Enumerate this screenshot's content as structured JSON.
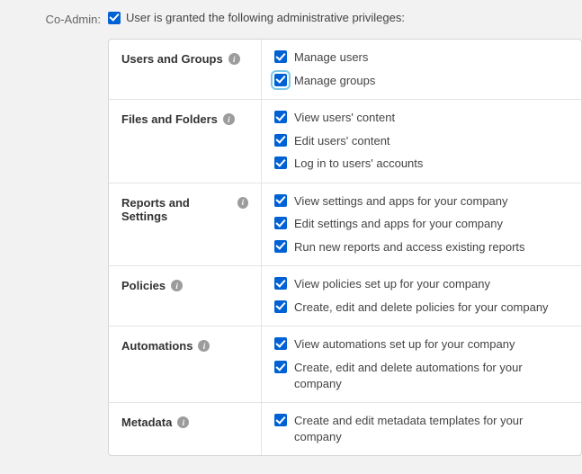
{
  "field_label": "Co-Admin:",
  "master_label": "User is granted the following administrative privileges:",
  "master_checked": true,
  "info_glyph": "i",
  "sections": [
    {
      "id": "users-groups",
      "title": "Users and Groups",
      "options": [
        {
          "id": "manage-users",
          "label": "Manage users",
          "checked": true,
          "highlight": false
        },
        {
          "id": "manage-groups",
          "label": "Manage groups",
          "checked": true,
          "highlight": true
        }
      ]
    },
    {
      "id": "files-folders",
      "title": "Files and Folders",
      "options": [
        {
          "id": "view-content",
          "label": "View users' content",
          "checked": true,
          "highlight": false
        },
        {
          "id": "edit-content",
          "label": "Edit users' content",
          "checked": true,
          "highlight": false
        },
        {
          "id": "login-accounts",
          "label": "Log in to users' accounts",
          "checked": true,
          "highlight": false
        }
      ]
    },
    {
      "id": "reports-settings",
      "title": "Reports and Settings",
      "options": [
        {
          "id": "view-settings",
          "label": "View settings and apps for your company",
          "checked": true,
          "highlight": false
        },
        {
          "id": "edit-settings",
          "label": "Edit settings and apps for your company",
          "checked": true,
          "highlight": false
        },
        {
          "id": "run-reports",
          "label": "Run new reports and access existing reports",
          "checked": true,
          "highlight": false
        }
      ]
    },
    {
      "id": "policies",
      "title": "Policies",
      "options": [
        {
          "id": "view-policies",
          "label": "View policies set up for your company",
          "checked": true,
          "highlight": false
        },
        {
          "id": "edit-policies",
          "label": "Create, edit and delete policies for your company",
          "checked": true,
          "highlight": false
        }
      ]
    },
    {
      "id": "automations",
      "title": "Automations",
      "options": [
        {
          "id": "view-automations",
          "label": "View automations set up for your company",
          "checked": true,
          "highlight": false
        },
        {
          "id": "edit-automations",
          "label": "Create, edit and delete automations for your company",
          "checked": true,
          "highlight": false
        }
      ]
    },
    {
      "id": "metadata",
      "title": "Metadata",
      "options": [
        {
          "id": "edit-metadata",
          "label": "Create and edit metadata templates for your company",
          "checked": true,
          "highlight": false
        }
      ]
    }
  ]
}
